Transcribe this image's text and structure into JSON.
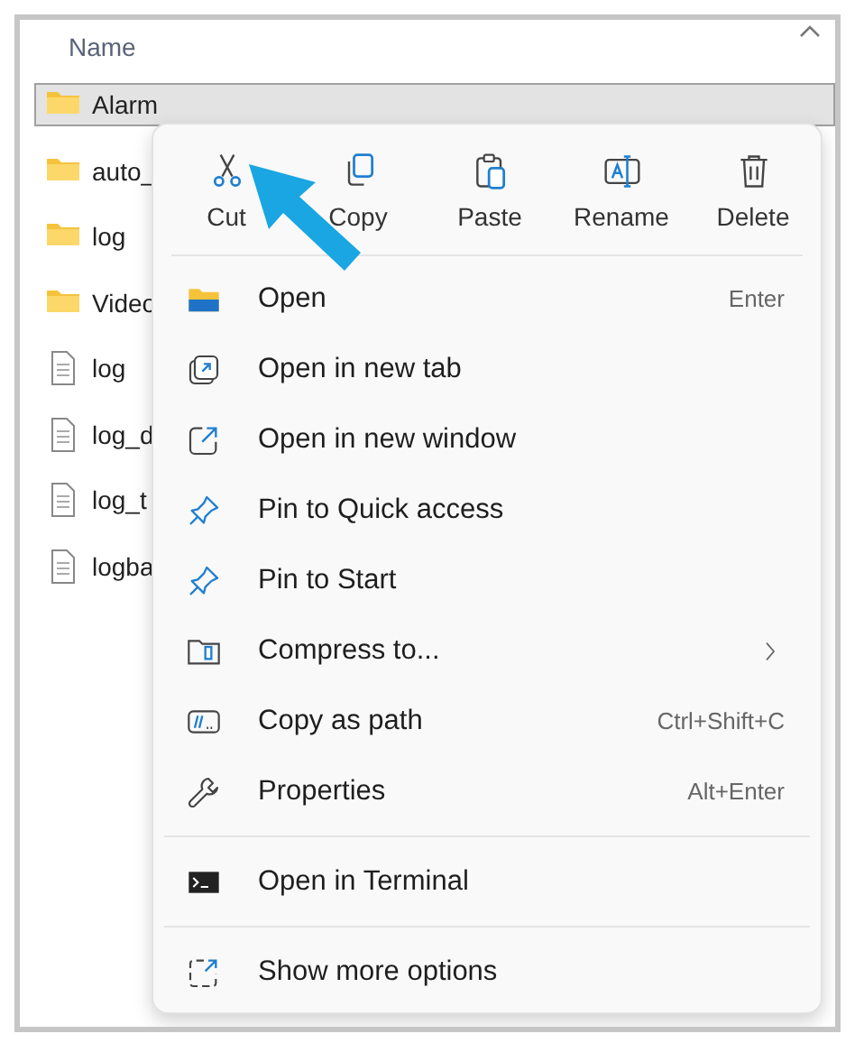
{
  "column_header": "Name",
  "files": [
    {
      "name": "Alarm",
      "kind": "folder",
      "selected": true
    },
    {
      "name": "auto_",
      "kind": "folder",
      "selected": false
    },
    {
      "name": "log",
      "kind": "folder",
      "selected": false
    },
    {
      "name": "Video",
      "kind": "folder",
      "selected": false
    },
    {
      "name": "log",
      "kind": "file",
      "selected": false
    },
    {
      "name": "log_d",
      "kind": "file",
      "selected": false
    },
    {
      "name": "log_t",
      "kind": "file",
      "selected": false
    },
    {
      "name": "logba",
      "kind": "file",
      "selected": false
    }
  ],
  "quick_actions": [
    {
      "label": "Cut",
      "kind": "cut"
    },
    {
      "label": "Copy",
      "kind": "copy"
    },
    {
      "label": "Paste",
      "kind": "paste"
    },
    {
      "label": "Rename",
      "kind": "rename"
    },
    {
      "label": "Delete",
      "kind": "delete"
    }
  ],
  "sections": [
    {
      "items": [
        {
          "label": "Open",
          "shortcut": "Enter",
          "kind": "open",
          "submenu": false
        },
        {
          "label": "Open in new tab",
          "kind": "newtab",
          "submenu": false
        },
        {
          "label": "Open in new window",
          "kind": "newwindow",
          "submenu": false
        },
        {
          "label": "Pin to Quick access",
          "kind": "pin",
          "submenu": false
        },
        {
          "label": "Pin to Start",
          "kind": "pin",
          "submenu": false
        },
        {
          "label": "Compress to...",
          "kind": "compress",
          "submenu": true
        },
        {
          "label": "Copy as path",
          "shortcut": "Ctrl+Shift+C",
          "kind": "path",
          "submenu": false
        },
        {
          "label": "Properties",
          "shortcut": "Alt+Enter",
          "kind": "properties",
          "submenu": false
        }
      ]
    },
    {
      "items": [
        {
          "label": "Open in Terminal",
          "kind": "terminal",
          "submenu": false
        }
      ]
    },
    {
      "items": [
        {
          "label": "Show more options",
          "kind": "more",
          "submenu": false
        }
      ]
    }
  ]
}
